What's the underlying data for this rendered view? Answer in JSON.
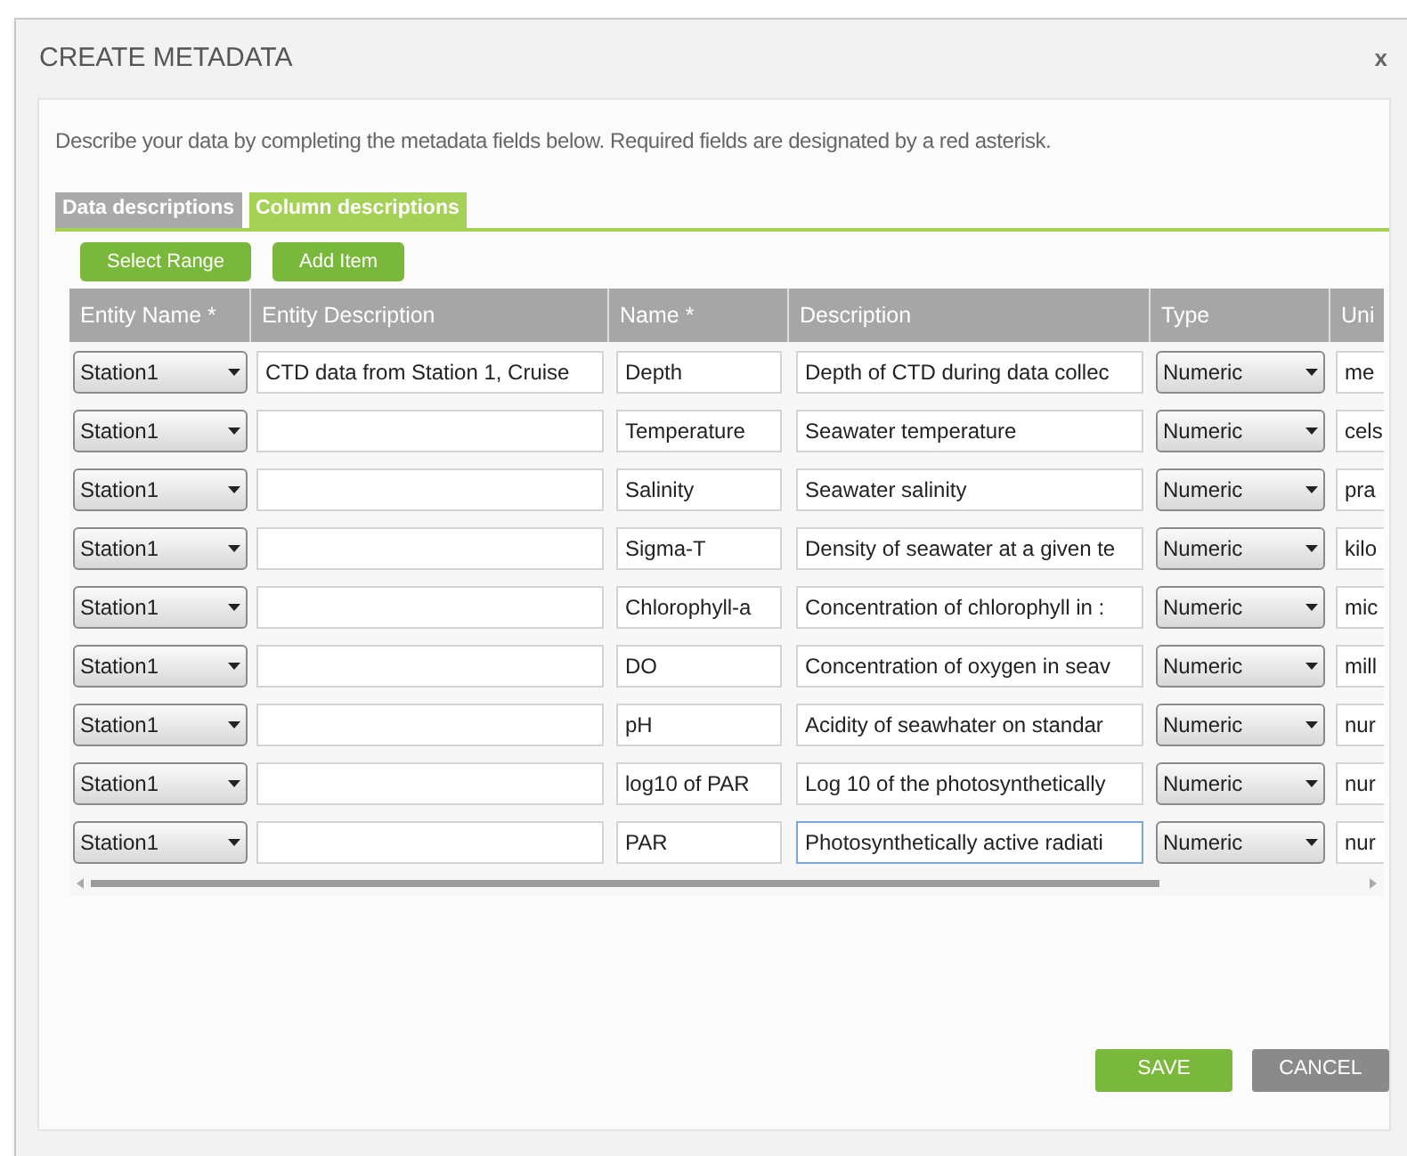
{
  "dialog": {
    "title": "CREATE METADATA",
    "close": "x"
  },
  "intro": "Describe your data by completing the metadata fields below. Required fields are designated by a red asterisk.",
  "tabs": [
    {
      "label": "Data descriptions",
      "selected": false
    },
    {
      "label": "Column descriptions",
      "selected": true
    }
  ],
  "toolbar": [
    "Select Range",
    "Add Item"
  ],
  "table": {
    "columns": [
      "Entity Name *",
      "Entity Description",
      "Name *",
      "Description",
      "Type",
      "Uni"
    ],
    "rows": [
      {
        "entity": "Station1",
        "entity_description": "CTD data from Station 1, Cruise",
        "name": "Depth",
        "description": "Depth of CTD during data collec",
        "focused": false,
        "type": "Numeric",
        "unit": "me"
      },
      {
        "entity": "Station1",
        "entity_description": "",
        "name": "Temperature",
        "description": "Seawater temperature",
        "focused": false,
        "type": "Numeric",
        "unit": "cels"
      },
      {
        "entity": "Station1",
        "entity_description": "",
        "name": "Salinity",
        "description": "Seawater salinity",
        "focused": false,
        "type": "Numeric",
        "unit": "pra"
      },
      {
        "entity": "Station1",
        "entity_description": "",
        "name": "Sigma-T",
        "description": "Density of seawater at a given te",
        "focused": false,
        "type": "Numeric",
        "unit": "kilo"
      },
      {
        "entity": "Station1",
        "entity_description": "",
        "name": "Chlorophyll-a",
        "description": "Concentration of chlorophyll in :",
        "focused": false,
        "type": "Numeric",
        "unit": "mic"
      },
      {
        "entity": "Station1",
        "entity_description": "",
        "name": "DO",
        "description": "Concentration of oxygen in seav",
        "focused": false,
        "type": "Numeric",
        "unit": "mill"
      },
      {
        "entity": "Station1",
        "entity_description": "",
        "name": "pH",
        "description": "Acidity of seawhater on standar",
        "focused": false,
        "type": "Numeric",
        "unit": "nur"
      },
      {
        "entity": "Station1",
        "entity_description": "",
        "name": "log10 of PAR",
        "description": "Log 10 of the photosynthetically",
        "focused": false,
        "type": "Numeric",
        "unit": "nur"
      },
      {
        "entity": "Station1",
        "entity_description": "",
        "name": "PAR",
        "description": "Photosynthetically active radiati",
        "focused": true,
        "type": "Numeric",
        "unit": "nur"
      }
    ]
  },
  "buttons": [
    {
      "label": "SAVE",
      "kind": "primary"
    },
    {
      "label": "CANCEL",
      "kind": "secondary"
    }
  ]
}
